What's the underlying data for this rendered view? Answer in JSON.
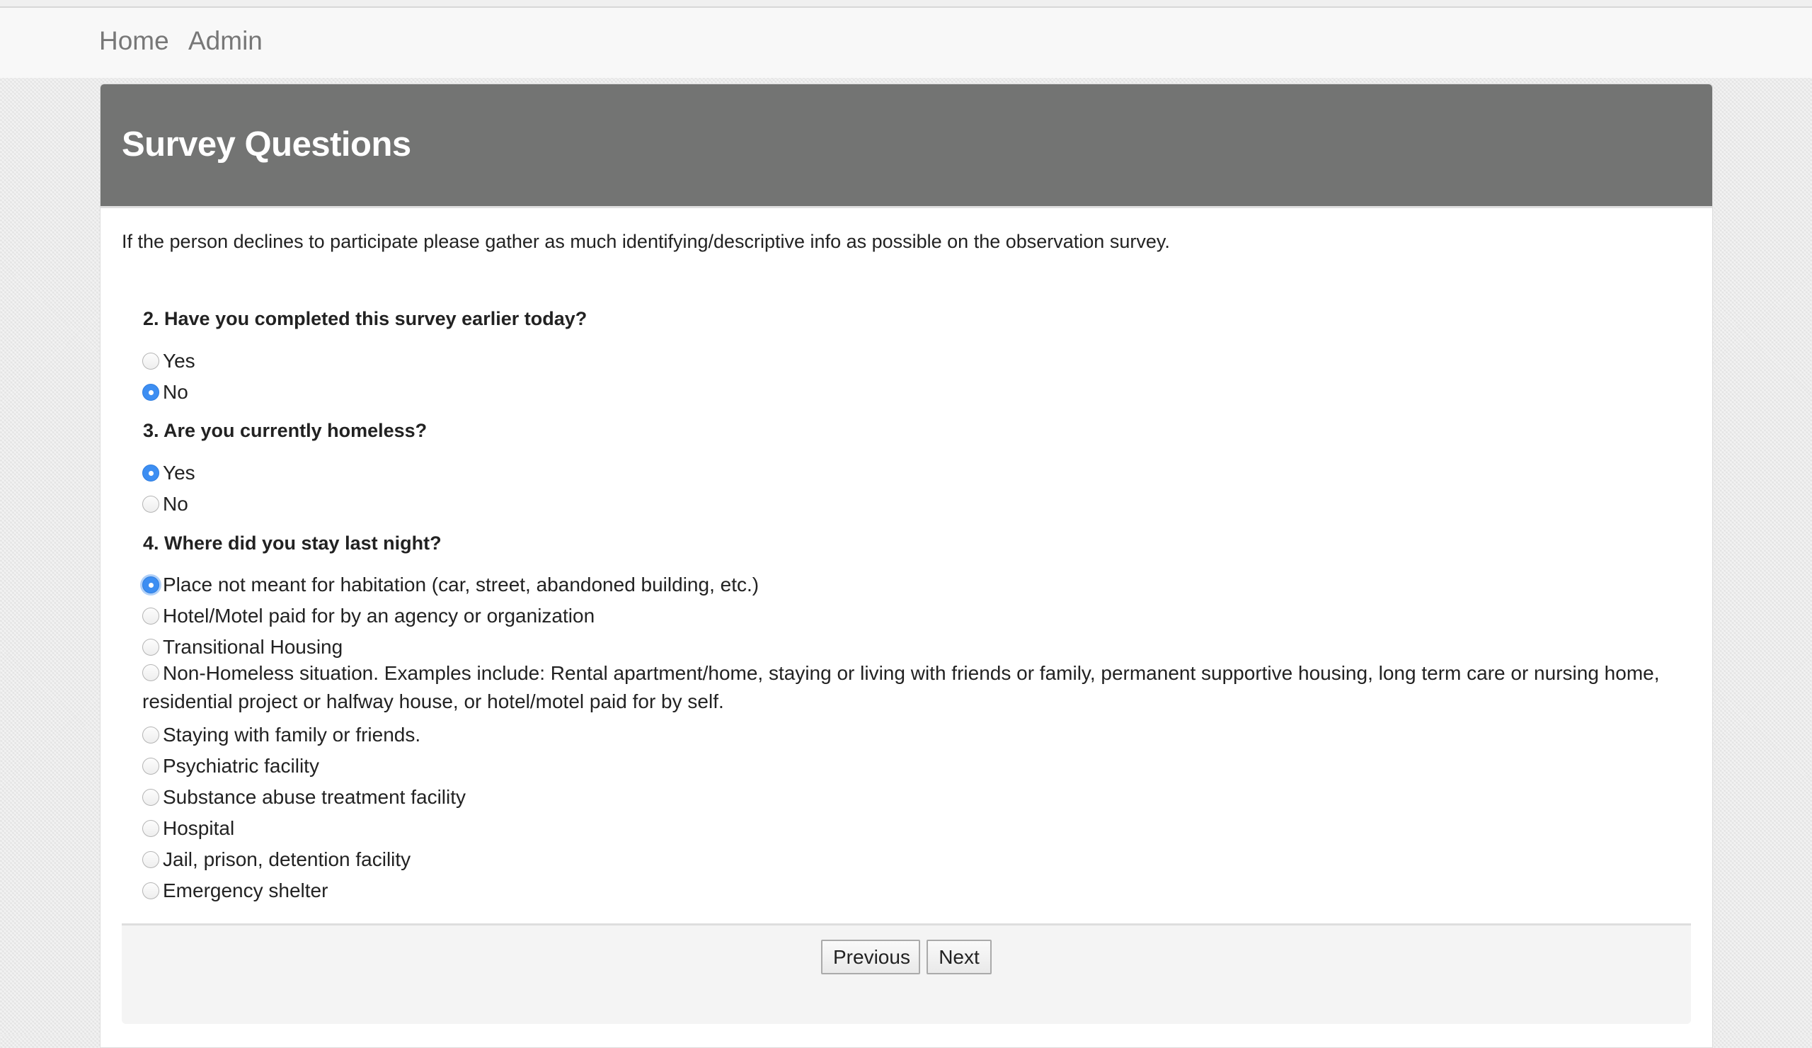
{
  "nav": {
    "items": [
      {
        "label": "Home"
      },
      {
        "label": "Admin"
      }
    ]
  },
  "page": {
    "title": "Survey Questions",
    "intro": "If the person declines to participate please gather as much identifying/descriptive info as possible on the observation survey."
  },
  "questions": [
    {
      "label": "2. Have you completed this survey earlier today?",
      "options": [
        {
          "label": "Yes",
          "checked": false
        },
        {
          "label": "No",
          "checked": true
        }
      ]
    },
    {
      "label": "3. Are you currently homeless?",
      "options": [
        {
          "label": "Yes",
          "checked": true
        },
        {
          "label": "No",
          "checked": false
        }
      ]
    },
    {
      "label": "4. Where did you stay last night?",
      "options": [
        {
          "label": "Place not meant for habitation (car, street, abandoned building, etc.)",
          "checked": true,
          "focused": true
        },
        {
          "label": "Hotel/Motel paid for by an agency or organization",
          "checked": false
        },
        {
          "label": "Transitional Housing",
          "checked": false
        },
        {
          "label": "Non-Homeless situation. Examples include: Rental apartment/home, staying or living with friends or family, permanent supportive housing, long term care or nursing home, residential project or halfway house, or hotel/motel paid for by self.",
          "checked": false
        },
        {
          "label": "Staying with family or friends.",
          "checked": false
        },
        {
          "label": "Psychiatric facility",
          "checked": false
        },
        {
          "label": "Substance abuse treatment facility",
          "checked": false
        },
        {
          "label": "Hospital",
          "checked": false
        },
        {
          "label": "Jail, prison, detention facility",
          "checked": false
        },
        {
          "label": "Emergency shelter",
          "checked": false
        }
      ]
    }
  ],
  "footer": {
    "previous_label": "Previous",
    "next_label": "Next"
  },
  "colors": {
    "header_bg": "#737473",
    "radio_checked": "#3d8ef2",
    "nav_link": "#777777"
  }
}
